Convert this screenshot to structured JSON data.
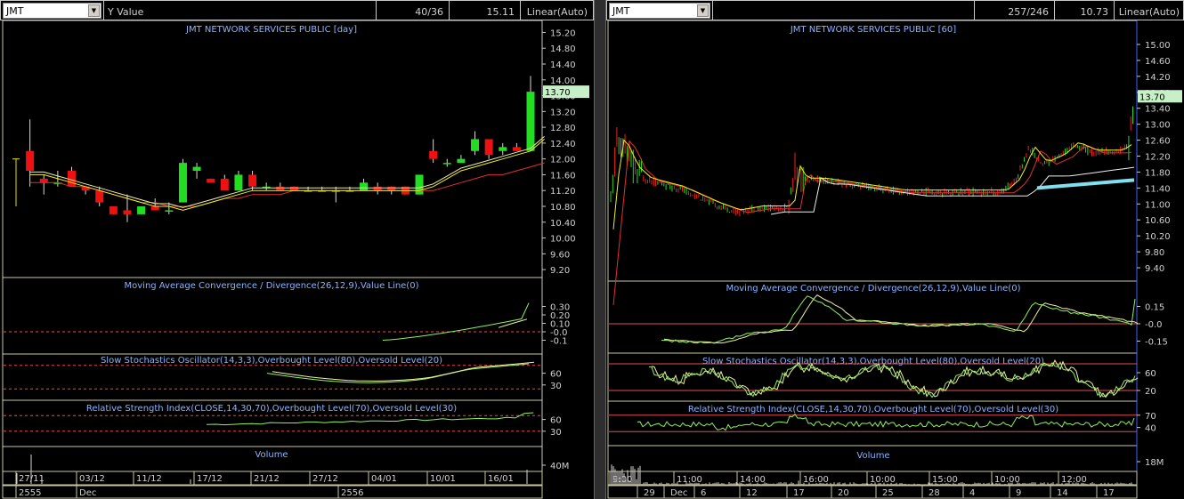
{
  "left": {
    "symbol": "JMT",
    "field": "Y Value",
    "ratio": "40/36",
    "value": "15.11",
    "scale": "Linear(Auto)",
    "title": "JMT NETWORK SERVICES PUBLIC [day]",
    "price_ticks": [
      "15.20",
      "14.80",
      "14.40",
      "14.00",
      "13.60",
      "13.20",
      "12.80",
      "12.40",
      "12.00",
      "11.60",
      "11.20",
      "10.80",
      "10.40",
      "10.00",
      "9.60",
      "9.20"
    ],
    "last_price": "13.70",
    "macd_title": "Moving Average Convergence / Divergence(26,12,9),Value Line(0)",
    "macd_ticks": [
      "0.30",
      "0.20",
      "0.10",
      "-0.0",
      "-0.1"
    ],
    "stoch_title": "Slow Stochastics Oscillator(14,3,3),Overbought Level(80),Oversold Level(20)",
    "stoch_ticks": [
      "60",
      "30"
    ],
    "rsi_title": "Relative Strength Index(CLOSE,14,30,70),Overbought Level(70),Oversold Level(30)",
    "rsi_ticks": [
      "60",
      "30"
    ],
    "volume_title": "Volume",
    "volume_tick": "40M",
    "date_labels": [
      "27/11",
      "03/12",
      "11/12",
      "17/12",
      "21/12",
      "27/12",
      "04/01",
      "10/01",
      "16/01"
    ],
    "period_labels": [
      "2555",
      "Dec",
      "2556"
    ]
  },
  "right": {
    "symbol": "JMT",
    "ratio": "257/246",
    "value": "10.73",
    "scale": "Linear(Auto)",
    "title": "JMT NETWORK SERVICES PUBLIC [60]",
    "price_ticks": [
      "15.00",
      "14.60",
      "14.20",
      "13.80",
      "13.40",
      "13.00",
      "12.60",
      "12.20",
      "11.80",
      "11.40",
      "11.00",
      "10.60",
      "10.20",
      "9.80",
      "9.40"
    ],
    "last_price": "13.70",
    "macd_title": "Moving Average Convergence / Divergence(26,12,9),Value Line(0)",
    "macd_ticks": [
      "0.15",
      "-0.0",
      "-0.15"
    ],
    "stoch_title": "Slow Stochastics Oscillator(14,3,3),Overbought Level(80),Oversold Level(20)",
    "stoch_ticks": [
      "60",
      "20"
    ],
    "rsi_title": "Relative Strength Index(CLOSE,14,30,70),Overbought Level(70),Oversold Level(30)",
    "rsi_ticks": [
      "70",
      "40"
    ],
    "volume_title": "Volume",
    "volume_tick": "18M",
    "time_labels": [
      "9:00",
      "11:00",
      "14:00",
      "16:00",
      "10:00",
      "15:00",
      "10:00",
      "12:00"
    ],
    "day_labels": [
      "29",
      "Dec",
      "6",
      "12",
      "17",
      "20",
      "25",
      "28",
      "4",
      "9",
      "14",
      "17"
    ]
  },
  "chart_data": [
    {
      "type": "candlestick",
      "title": "JMT NETWORK SERVICES PUBLIC [day]",
      "yrange": [
        9.0,
        15.3
      ],
      "candles": [
        {
          "o": 12.0,
          "h": 12.0,
          "l": 10.8,
          "c": 12.0
        },
        {
          "o": 12.2,
          "h": 13.0,
          "l": 11.3,
          "c": 11.7
        },
        {
          "o": 11.5,
          "h": 11.6,
          "l": 11.1,
          "c": 11.4
        },
        {
          "o": 11.4,
          "h": 11.7,
          "l": 11.3,
          "c": 11.4
        },
        {
          "o": 11.7,
          "h": 11.8,
          "l": 11.3,
          "c": 11.3
        },
        {
          "o": 11.3,
          "h": 11.3,
          "l": 11.1,
          "c": 11.2
        },
        {
          "o": 11.2,
          "h": 11.3,
          "l": 10.8,
          "c": 10.9
        },
        {
          "o": 10.8,
          "h": 10.8,
          "l": 10.6,
          "c": 10.6
        },
        {
          "o": 10.7,
          "h": 11.1,
          "l": 10.4,
          "c": 10.6
        },
        {
          "o": 10.6,
          "h": 10.8,
          "l": 10.6,
          "c": 10.8
        },
        {
          "o": 10.8,
          "h": 11.0,
          "l": 10.7,
          "c": 10.7
        },
        {
          "o": 10.7,
          "h": 10.9,
          "l": 10.6,
          "c": 10.7
        },
        {
          "o": 10.9,
          "h": 12.0,
          "l": 10.9,
          "c": 11.9
        },
        {
          "o": 11.7,
          "h": 11.9,
          "l": 11.5,
          "c": 11.8
        },
        {
          "o": 11.5,
          "h": 11.5,
          "l": 11.4,
          "c": 11.4
        },
        {
          "o": 11.5,
          "h": 11.6,
          "l": 11.2,
          "c": 11.2
        },
        {
          "o": 11.2,
          "h": 11.7,
          "l": 11.2,
          "c": 11.6
        },
        {
          "o": 11.6,
          "h": 11.7,
          "l": 11.2,
          "c": 11.3
        },
        {
          "o": 11.3,
          "h": 11.4,
          "l": 11.2,
          "c": 11.3
        },
        {
          "o": 11.3,
          "h": 11.4,
          "l": 11.2,
          "c": 11.2
        },
        {
          "o": 11.3,
          "h": 11.3,
          "l": 11.2,
          "c": 11.2
        },
        {
          "o": 11.2,
          "h": 11.3,
          "l": 11.2,
          "c": 11.2
        },
        {
          "o": 11.2,
          "h": 11.3,
          "l": 11.2,
          "c": 11.2
        },
        {
          "o": 11.2,
          "h": 11.3,
          "l": 10.9,
          "c": 11.2
        },
        {
          "o": 11.2,
          "h": 11.3,
          "l": 11.2,
          "c": 11.2
        },
        {
          "o": 11.2,
          "h": 11.5,
          "l": 11.2,
          "c": 11.4
        },
        {
          "o": 11.3,
          "h": 11.4,
          "l": 11.1,
          "c": 11.2
        },
        {
          "o": 11.3,
          "h": 11.3,
          "l": 11.1,
          "c": 11.2
        },
        {
          "o": 11.3,
          "h": 11.3,
          "l": 11.1,
          "c": 11.1
        },
        {
          "o": 11.1,
          "h": 11.6,
          "l": 11.1,
          "c": 11.6
        },
        {
          "o": 12.2,
          "h": 12.5,
          "l": 11.9,
          "c": 12.0
        },
        {
          "o": 11.9,
          "h": 12.0,
          "l": 11.8,
          "c": 11.9
        },
        {
          "o": 11.9,
          "h": 12.1,
          "l": 11.9,
          "c": 12.0
        },
        {
          "o": 12.2,
          "h": 12.7,
          "l": 12.1,
          "c": 12.5
        },
        {
          "o": 12.5,
          "h": 12.5,
          "l": 12.0,
          "c": 12.1
        },
        {
          "o": 12.2,
          "h": 12.4,
          "l": 12.1,
          "c": 12.3
        },
        {
          "o": 12.3,
          "h": 12.4,
          "l": 12.2,
          "c": 12.2
        },
        {
          "o": 12.2,
          "h": 14.1,
          "l": 12.2,
          "c": 13.7
        }
      ],
      "ma_fast": [
        11.6,
        11.6,
        11.5,
        11.4,
        11.3,
        11.2,
        11.1,
        11.0,
        10.9,
        10.8,
        10.8,
        10.7,
        10.8,
        10.9,
        11.0,
        11.1,
        11.2,
        11.2,
        11.2,
        11.2,
        11.2,
        11.2,
        11.2,
        11.2,
        11.2,
        11.2,
        11.2,
        11.2,
        11.2,
        11.3,
        11.5,
        11.7,
        11.8,
        11.9,
        12.0,
        12.1,
        12.2,
        12.5
      ],
      "ma_slow": [
        11.4,
        11.4,
        11.4,
        11.3,
        11.3,
        11.2,
        11.1,
        11.0,
        10.9,
        10.9,
        10.8,
        10.8,
        10.8,
        10.9,
        11.0,
        11.0,
        11.1,
        11.1,
        11.1,
        11.2,
        11.2,
        11.2,
        11.2,
        11.2,
        11.2,
        11.2,
        11.2,
        11.2,
        11.2,
        11.2,
        11.3,
        11.4,
        11.5,
        11.6,
        11.6,
        11.7,
        11.8,
        11.9
      ]
    },
    {
      "type": "candlestick",
      "title": "JMT NETWORK SERVICES PUBLIC [60]",
      "yrange": [
        9.2,
        15.2
      ],
      "ma_levels": {
        "line": [
          11.0,
          12.2,
          11.6,
          10.9,
          10.6,
          11.4,
          11.4,
          11.3,
          11.2,
          11.3,
          12.0,
          12.2,
          12.3,
          13.7
        ]
      }
    }
  ]
}
